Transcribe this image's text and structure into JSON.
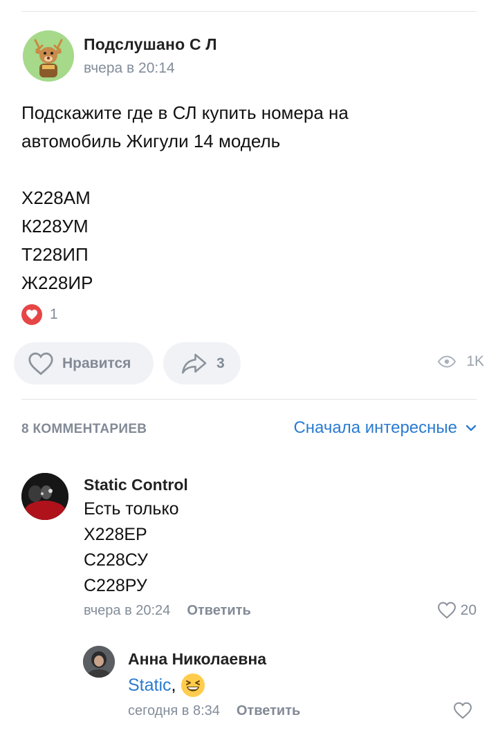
{
  "post": {
    "author": "Подслушано С     Л",
    "time": "вчера в 20:14",
    "text_lines": [
      "Подскажите где в СЛ купить номера на",
      "автомобиль Жигули 14 модель",
      "",
      "Х228АМ",
      "К228УМ",
      "Т228ИП",
      "Ж228ИР"
    ],
    "reaction_count": "1",
    "like_label": "Нравится",
    "share_count": "3",
    "views": "1K"
  },
  "comments_header": {
    "count_label": "8 КОММЕНТАРИЕВ",
    "sort_label": "Сначала интересные"
  },
  "comments": [
    {
      "author": "Static Control",
      "lines": [
        "Есть только",
        "Х228ЕР",
        "С228СУ",
        "С228РУ"
      ],
      "time": "вчера в 20:24",
      "reply_label": "Ответить",
      "likes": "20"
    },
    {
      "author": "Анна Николаевна",
      "mention": "Static",
      "after_mention": ",",
      "emoji": "grinning-squinting-face",
      "time": "сегодня в 8:34",
      "reply_label": "Ответить",
      "likes": ""
    }
  ],
  "colors": {
    "accent": "#2a7bd0",
    "secondary_text": "#818c99",
    "pill_bg": "#f0f2f5",
    "reaction_red": "#e64646"
  }
}
